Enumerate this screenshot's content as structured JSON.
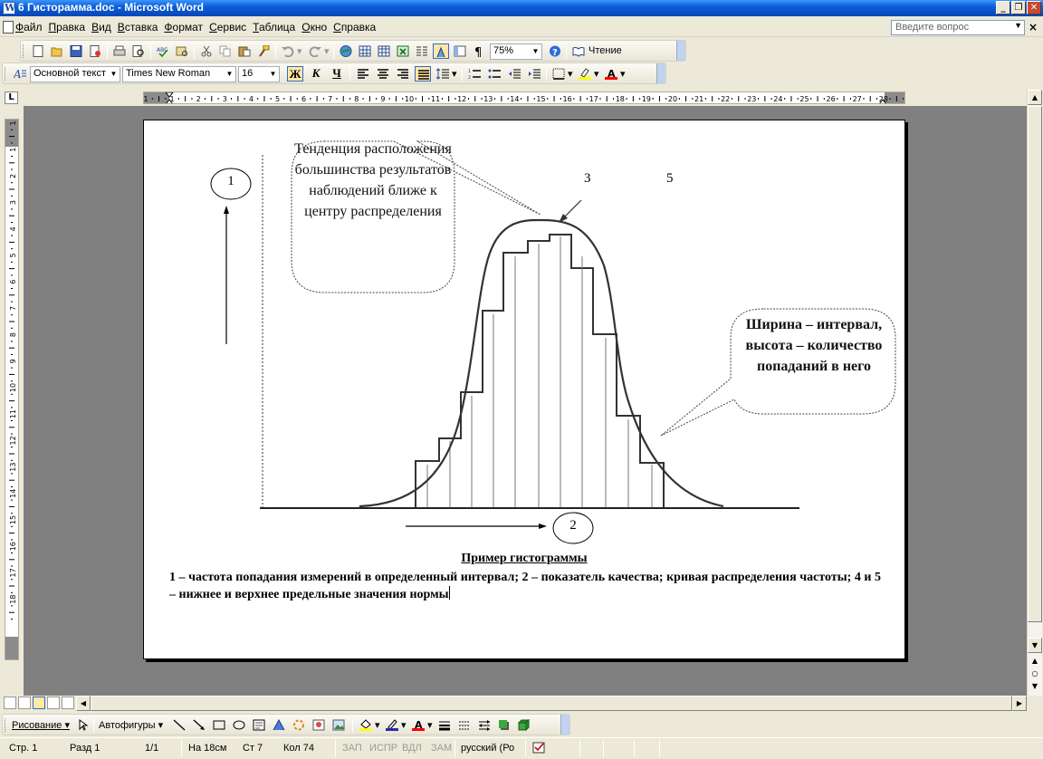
{
  "window": {
    "title": "6 Гисторамма.doc - Microsoft Word",
    "controls": {
      "minimize": "_",
      "maximize": "❐",
      "close": "✕"
    }
  },
  "menu": {
    "items": [
      "Файл",
      "Правка",
      "Вид",
      "Вставка",
      "Формат",
      "Сервис",
      "Таблица",
      "Окно",
      "Справка"
    ],
    "ask_placeholder": "Введите вопрос",
    "doc_close": "×"
  },
  "standard_toolbar": {
    "zoom": "75%",
    "reading_label": "Чтение"
  },
  "formatting_toolbar": {
    "style": "Основной текст",
    "font": "Times New Roman",
    "size": "16",
    "bold_label": "Ж",
    "italic_label": "К",
    "underline_label": "Ч"
  },
  "rulers": {
    "horizontal_numbers": [
      "1",
      "1",
      "2",
      "3",
      "4",
      "5",
      "6",
      "7",
      "8",
      "9",
      "10",
      "11",
      "12",
      "13",
      "14",
      "15",
      "16",
      "17",
      "18",
      "19",
      "20",
      "21",
      "22",
      "23",
      "24",
      "25",
      "26",
      "27",
      "28"
    ],
    "vertical_numbers": [
      "1",
      "1",
      "2",
      "3",
      "4",
      "5",
      "6",
      "7",
      "8",
      "9",
      "10",
      "11",
      "12",
      "13",
      "14",
      "15",
      "16",
      "17",
      "18"
    ],
    "tab_selector": "L"
  },
  "document": {
    "callout_left": "Тенденция расположения большинства результатов наблюдений ближе к центру распределения",
    "callout_right": "Ширина – интервал, высота – количество попаданий в него",
    "label_1": "1",
    "label_2": "2",
    "label_3": "3",
    "label_5": "5",
    "caption_title": "Пример гистограммы",
    "caption_body": "1 – частота попадания измерений в определенный интервал; 2 – показатель качества; кривая распределения частоты; 4 и 5 – нижнее и верхнее предельные значения нормы"
  },
  "drawing_toolbar": {
    "draw_label": "Рисование",
    "autoshapes_label": "Автофигуры"
  },
  "statusbar": {
    "page": "Стр. 1",
    "section": "Разд 1",
    "pages": "1/1",
    "at": "На 18см",
    "line": "Ст 7",
    "col": "Кол 74",
    "rec": "ЗАП",
    "trk": "ИСПР",
    "ext": "ВДЛ",
    "ovr": "ЗАМ",
    "language": "русский (Ро"
  },
  "colors": {
    "titlebar": "#0a5fd8",
    "workspace": "#808080",
    "chrome": "#ece9d8"
  }
}
